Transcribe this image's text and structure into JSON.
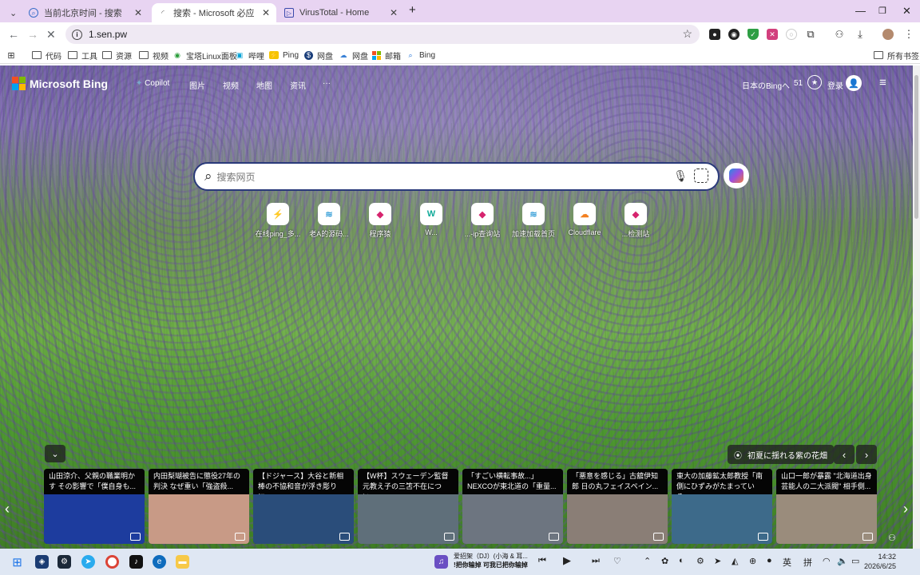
{
  "tabs": [
    {
      "title": "当前北京时间 - 搜索",
      "favicon": "bing-search-icon"
    },
    {
      "title": "搜索 - Microsoft 必应",
      "favicon": "loading-icon"
    },
    {
      "title": "VirusTotal - Home",
      "favicon": "virustotal-icon"
    }
  ],
  "address": {
    "url": "1.sen.pw"
  },
  "bookmarks": [
    {
      "label": "代码"
    },
    {
      "label": "工具"
    },
    {
      "label": "资源"
    },
    {
      "label": "视频"
    },
    {
      "label": "宝塔Linux面板"
    },
    {
      "label": "哔哩"
    },
    {
      "label": "Ping"
    },
    {
      "label": "网盘"
    },
    {
      "label": "网盘"
    },
    {
      "label": "邮箱"
    },
    {
      "label": "Bing"
    }
  ],
  "all_bookmarks": "所有书签",
  "bing": {
    "logo": "Microsoft Bing",
    "nav": [
      "Copilot",
      "图片",
      "视频",
      "地图",
      "资讯",
      "···"
    ],
    "region": "日本のBingへ",
    "points": "51",
    "signin": "登录",
    "search_placeholder": "搜索网页",
    "quicklinks": [
      {
        "label": "在线ping_多...",
        "glyph": "⚡",
        "color": "#111"
      },
      {
        "label": "老A的源码...",
        "glyph": "≋",
        "color": "#3aa0d8"
      },
      {
        "label": "程序猿",
        "glyph": "◆",
        "color": "#d6246e"
      },
      {
        "label": "W...",
        "glyph": "W",
        "color": "#1a9"
      },
      {
        "label": "...-ip查询站",
        "glyph": "◆",
        "color": "#d6246e"
      },
      {
        "label": "加速加载首页",
        "glyph": "≋",
        "color": "#3aa0d8"
      },
      {
        "label": "Cloudflare",
        "glyph": "☁",
        "color": "#f38020"
      },
      {
        "label": "...检测站",
        "glyph": "◆",
        "color": "#d6246e"
      }
    ],
    "image_caption": "初夏に揺れる紫の花畑",
    "news": [
      {
        "title": "山田涼介、父親の職業明かす その影響で「僕自身も...",
        "bg": "#1d3c9e"
      },
      {
        "title": "内田梨瑚被告に懲役27年の判決 なぜ重い「強盗殺...",
        "bg": "#c89a86"
      },
      {
        "title": "【ドジャース】大谷と新相棒の不協和音が浮き彫りに...",
        "bg": "#2a4d7a"
      },
      {
        "title": "【W杯】スウェーデン監督 元教え子の三笘不在につい...",
        "bg": "#5f6f7a"
      },
      {
        "title": "「すごい横転事故...」 NEXCOが東北道の「重量...",
        "bg": "#6d7580"
      },
      {
        "title": "「悪意を感じる」古舘伊知郎 日の丸フェイスペイン...",
        "bg": "#8a7e76"
      },
      {
        "title": "東大の加藤鉱太郎教授「南側にひずみがたまっている...",
        "bg": "#3d6a8a"
      },
      {
        "title": "山口一郎が暴露 \"北海道出身芸能人の二大派閥\" 相手側...",
        "bg": "#9a8c7c"
      }
    ]
  },
  "taskbar": {
    "media_line1": "爱招架（DJ）(小海 & 耳...",
    "media_line2": "!把你输掉 可我已把你输掉",
    "ime1": "英",
    "ime2": "拼",
    "time": "14:32",
    "date": "2026/6/25"
  }
}
